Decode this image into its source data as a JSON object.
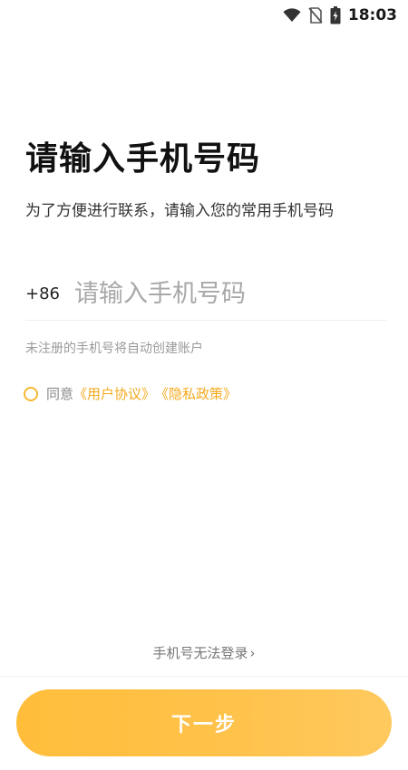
{
  "status_bar": {
    "time": "18:03",
    "icons": [
      "wifi-icon",
      "sim-blocked-icon",
      "battery-charging-icon"
    ]
  },
  "login": {
    "title": "请输入手机号码",
    "subtitle": "为了方便进行联系，请输入您的常用手机号码",
    "country_code": "+86",
    "phone_placeholder": "请输入手机号码",
    "phone_value": "",
    "hint": "未注册的手机号将自动创建账户",
    "agree_prefix": "同意",
    "user_agreement": "《用户协议》",
    "privacy_policy": "《隐私政策》",
    "cannot_login": "手机号无法登录",
    "next_button": "下一步"
  },
  "colors": {
    "accent": "#f4a91d",
    "button_gradient_start": "#ffbd3a",
    "button_gradient_end": "#ffc95e",
    "hint_text": "#9a9a9a"
  }
}
